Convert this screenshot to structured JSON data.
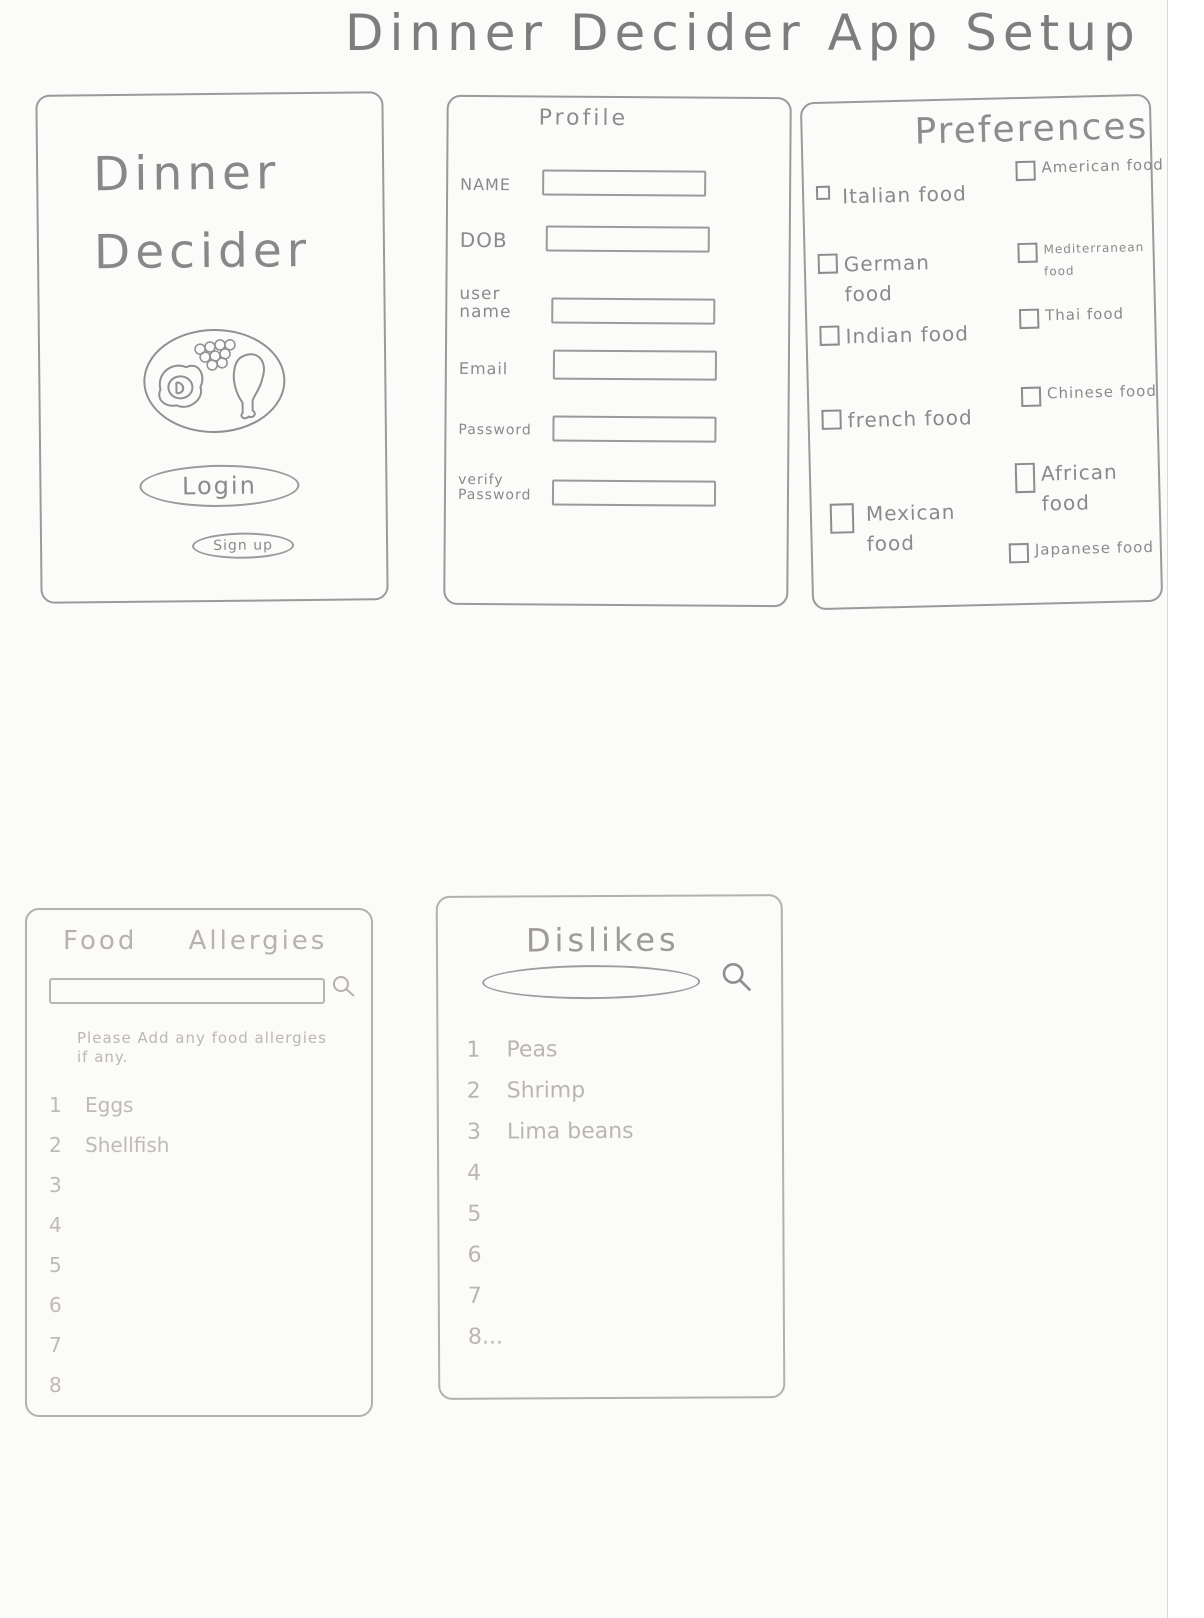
{
  "page": {
    "title": "Dinner Decider App Setup"
  },
  "login_screen": {
    "app_name_line1": "Dinner",
    "app_name_line2": "Decider",
    "login_label": "Login",
    "signup_label": "Sign up",
    "logo_icon": "plate-with-food-icon"
  },
  "profile_screen": {
    "title": "Profile",
    "fields": [
      {
        "label": "NAME",
        "value": ""
      },
      {
        "label": "DOB",
        "value": ""
      },
      {
        "label": "user name",
        "value": ""
      },
      {
        "label": "Email",
        "value": ""
      },
      {
        "label": "Password",
        "value": ""
      },
      {
        "label": "verify Password",
        "value": ""
      }
    ]
  },
  "preferences_screen": {
    "title": "Preferences",
    "options": [
      {
        "label": "Italian food",
        "checked": false
      },
      {
        "label": "American food",
        "checked": false
      },
      {
        "label": "German food",
        "checked": false
      },
      {
        "label": "Mediterranean food",
        "checked": false
      },
      {
        "label": "Indian food",
        "checked": false
      },
      {
        "label": "Thai food",
        "checked": false
      },
      {
        "label": "french food",
        "checked": false
      },
      {
        "label": "Chinese food",
        "checked": false
      },
      {
        "label": "Mexican food",
        "checked": false
      },
      {
        "label": "African food",
        "checked": false
      },
      {
        "label": "Japanese food",
        "checked": false
      }
    ]
  },
  "allergies_screen": {
    "title": "Food Allergies",
    "search_value": "",
    "search_icon": "search-icon",
    "note": "Please Add any food allergies if any.",
    "items": [
      {
        "num": "1",
        "text": "Eggs"
      },
      {
        "num": "2",
        "text": "Shellfish"
      },
      {
        "num": "3",
        "text": ""
      },
      {
        "num": "4",
        "text": ""
      },
      {
        "num": "5",
        "text": ""
      },
      {
        "num": "6",
        "text": ""
      },
      {
        "num": "7",
        "text": ""
      },
      {
        "num": "8",
        "text": ""
      }
    ]
  },
  "dislikes_screen": {
    "title": "Dislikes",
    "search_value": "",
    "search_icon": "search-icon",
    "items": [
      {
        "num": "1",
        "text": "Peas"
      },
      {
        "num": "2",
        "text": "Shrimp"
      },
      {
        "num": "3",
        "text": "Lima beans"
      },
      {
        "num": "4",
        "text": ""
      },
      {
        "num": "5",
        "text": ""
      },
      {
        "num": "6",
        "text": ""
      },
      {
        "num": "7",
        "text": ""
      },
      {
        "num": "8...",
        "text": ""
      }
    ]
  },
  "colors": {
    "paper": "#fbfbfa",
    "pencil_dark": "#8a8a8a",
    "pencil_faint": "#c0bab6"
  }
}
